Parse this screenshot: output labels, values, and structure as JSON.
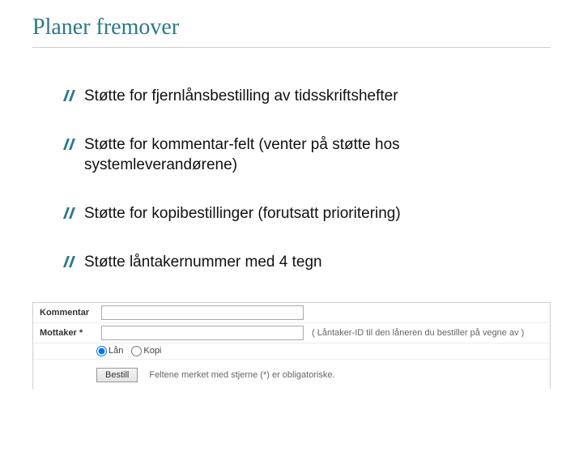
{
  "title": "Planer fremover",
  "bullets": [
    "Støtte for fjernlånsbestilling av tidsskriftshefter",
    "Støtte for kommentar-felt (venter på støtte hos systemleverandørene)",
    "Støtte for kopibestillinger (forutsatt prioritering)",
    "Støtte låntakernummer med 4 tegn"
  ],
  "form": {
    "kommentar_label": "Kommentar",
    "mottaker_label": "Mottaker *",
    "mottaker_hint": "( Låntaker-ID til den låneren du bestiller på vegne av )",
    "radio_lan": "Lån",
    "radio_kopi": "Kopi",
    "submit": "Bestill",
    "required_note": "Feltene merket med stjerne (*) er obligatoriske."
  }
}
